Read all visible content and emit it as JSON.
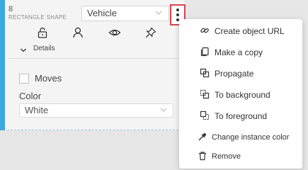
{
  "object": {
    "id": "8",
    "type_label": "RECTANGLE SHAPE",
    "label_value": "Vehicle"
  },
  "toolbar": {
    "icons": [
      "lock-open-icon",
      "user-icon",
      "eye-icon",
      "pin-icon"
    ]
  },
  "details": {
    "toggle_label": "Details",
    "moves_label": "Moves",
    "moves_checked": false,
    "color_label": "Color",
    "color_value": "White"
  },
  "context_menu": {
    "items": [
      {
        "label": "Create object URL",
        "icon": "link-icon"
      },
      {
        "label": "Make a copy",
        "icon": "copy-icon"
      },
      {
        "label": "Propagate",
        "icon": "propagate-icon"
      },
      {
        "label": "To background",
        "icon": "to-background-icon"
      },
      {
        "label": "To foreground",
        "icon": "to-foreground-icon"
      },
      {
        "label": "Change instance color",
        "icon": "eyedropper-icon"
      },
      {
        "label": "Remove",
        "icon": "trash-icon"
      }
    ]
  },
  "colors": {
    "accent": "#3ca8dd",
    "highlight_border": "#d9444f"
  }
}
